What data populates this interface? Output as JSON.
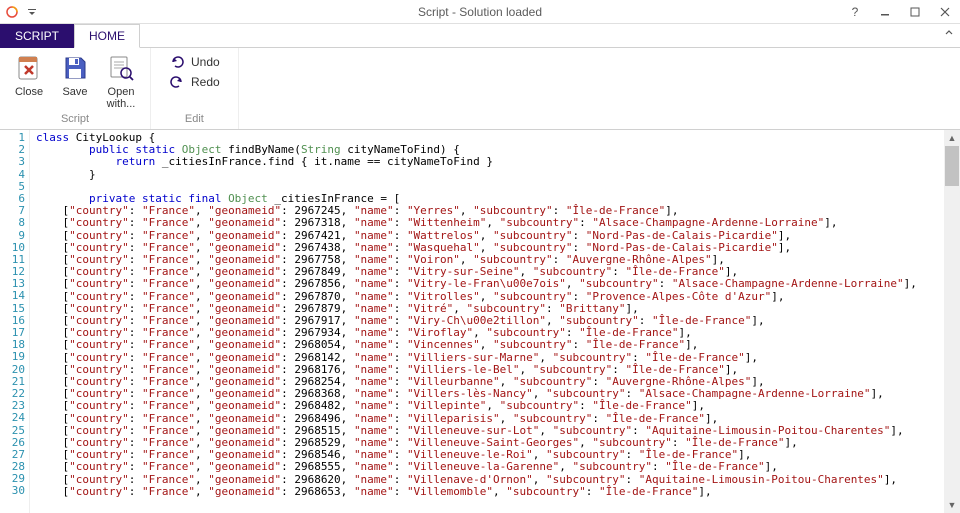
{
  "titlebar": {
    "title": "Script - Solution loaded"
  },
  "tabs": {
    "script": "SCRIPT",
    "home": "HOME"
  },
  "ribbon": {
    "close": "Close",
    "save": "Save",
    "openwith": "Open\nwith...",
    "undo": "Undo",
    "redo": "Redo",
    "group_script": "Script",
    "group_edit": "Edit"
  },
  "editor": {
    "lines": [
      {
        "n": 1,
        "t": "class CityLookup {",
        "seg": [
          [
            "kw",
            "class"
          ],
          [
            "",
            ", CityLookup {"
          ]
        ]
      },
      {
        "n": 2
      },
      {
        "n": 3
      },
      {
        "n": 4
      },
      {
        "n": 5
      },
      {
        "n": 6
      },
      {
        "n": 7
      },
      {
        "n": 8
      },
      {
        "n": 9
      },
      {
        "n": 10
      },
      {
        "n": 11
      },
      {
        "n": 12
      },
      {
        "n": 13
      },
      {
        "n": 14
      },
      {
        "n": 15
      },
      {
        "n": 16
      },
      {
        "n": 17
      },
      {
        "n": 18
      },
      {
        "n": 19
      },
      {
        "n": 20
      },
      {
        "n": 21
      },
      {
        "n": 22
      },
      {
        "n": 23
      },
      {
        "n": 24
      },
      {
        "n": 25
      },
      {
        "n": 26
      },
      {
        "n": 27
      },
      {
        "n": 28
      },
      {
        "n": 29
      },
      {
        "n": 30
      }
    ],
    "code": {
      "l1": "class CityLookup {",
      "l2": "        public static Object findByName(String cityNameToFind) {",
      "l3": "            return _citiesInFrance.find { it.name == cityNameToFind }",
      "l4": "        }",
      "l5": "",
      "l6": "        private static final Object _citiesInFrance = [",
      "rows": [
        {
          "id": 2967245,
          "name": "Yerres",
          "sub": "Île-de-France"
        },
        {
          "id": 2967318,
          "name": "Wittenheim",
          "sub": "Alsace-Champagne-Ardenne-Lorraine"
        },
        {
          "id": 2967421,
          "name": "Wattrelos",
          "sub": "Nord-Pas-de-Calais-Picardie"
        },
        {
          "id": 2967438,
          "name": "Wasquehal",
          "sub": "Nord-Pas-de-Calais-Picardie"
        },
        {
          "id": 2967758,
          "name": "Voiron",
          "sub": "Auvergne-Rhône-Alpes"
        },
        {
          "id": 2967849,
          "name": "Vitry-sur-Seine",
          "sub": "Île-de-France"
        },
        {
          "id": 2967856,
          "name": "Vitry-le-Fran\\u00e7ois",
          "sub": "Alsace-Champagne-Ardenne-Lorraine"
        },
        {
          "id": 2967870,
          "name": "Vitrolles",
          "sub": "Provence-Alpes-Côte d'Azur"
        },
        {
          "id": 2967879,
          "name": "Vitré",
          "sub": "Brittany"
        },
        {
          "id": 2967917,
          "name": "Viry-Ch\\u00e2tillon",
          "sub": "Île-de-France"
        },
        {
          "id": 2967934,
          "name": "Viroflay",
          "sub": "Île-de-France"
        },
        {
          "id": 2968054,
          "name": "Vincennes",
          "sub": "Île-de-France"
        },
        {
          "id": 2968142,
          "name": "Villiers-sur-Marne",
          "sub": "Île-de-France"
        },
        {
          "id": 2968176,
          "name": "Villiers-le-Bel",
          "sub": "Île-de-France"
        },
        {
          "id": 2968254,
          "name": "Villeurbanne",
          "sub": "Auvergne-Rhône-Alpes"
        },
        {
          "id": 2968368,
          "name": "Villers-lès-Nancy",
          "sub": "Alsace-Champagne-Ardenne-Lorraine"
        },
        {
          "id": 2968482,
          "name": "Villepinte",
          "sub": "Île-de-France"
        },
        {
          "id": 2968496,
          "name": "Villeparisis",
          "sub": "Île-de-France"
        },
        {
          "id": 2968515,
          "name": "Villeneuve-sur-Lot",
          "sub": "Aquitaine-Limousin-Poitou-Charentes"
        },
        {
          "id": 2968529,
          "name": "Villeneuve-Saint-Georges",
          "sub": "Île-de-France"
        },
        {
          "id": 2968546,
          "name": "Villeneuve-le-Roi",
          "sub": "Île-de-France"
        },
        {
          "id": 2968555,
          "name": "Villeneuve-la-Garenne",
          "sub": "Île-de-France"
        },
        {
          "id": 2968620,
          "name": "Villenave-d'Ornon",
          "sub": "Aquitaine-Limousin-Poitou-Charentes"
        },
        {
          "id": 2968653,
          "name": "Villemomble",
          "sub": "Île-de-France"
        }
      ]
    }
  }
}
